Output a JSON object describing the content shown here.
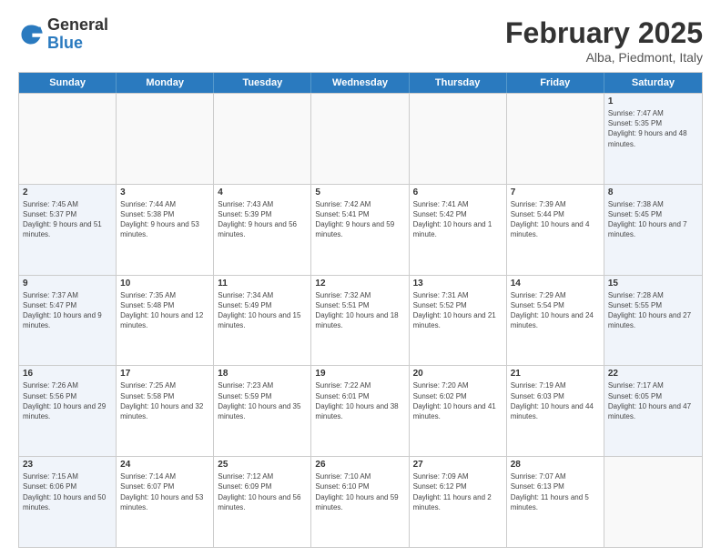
{
  "header": {
    "logo_general": "General",
    "logo_blue": "Blue",
    "month_title": "February 2025",
    "subtitle": "Alba, Piedmont, Italy"
  },
  "weekdays": [
    "Sunday",
    "Monday",
    "Tuesday",
    "Wednesday",
    "Thursday",
    "Friday",
    "Saturday"
  ],
  "rows": [
    [
      {
        "day": "",
        "info": "",
        "weekend": false,
        "empty": true
      },
      {
        "day": "",
        "info": "",
        "weekend": false,
        "empty": true
      },
      {
        "day": "",
        "info": "",
        "weekend": false,
        "empty": true
      },
      {
        "day": "",
        "info": "",
        "weekend": false,
        "empty": true
      },
      {
        "day": "",
        "info": "",
        "weekend": false,
        "empty": true
      },
      {
        "day": "",
        "info": "",
        "weekend": false,
        "empty": true
      },
      {
        "day": "1",
        "info": "Sunrise: 7:47 AM\nSunset: 5:35 PM\nDaylight: 9 hours and 48 minutes.",
        "weekend": true,
        "empty": false
      }
    ],
    [
      {
        "day": "2",
        "info": "Sunrise: 7:45 AM\nSunset: 5:37 PM\nDaylight: 9 hours and 51 minutes.",
        "weekend": true,
        "empty": false
      },
      {
        "day": "3",
        "info": "Sunrise: 7:44 AM\nSunset: 5:38 PM\nDaylight: 9 hours and 53 minutes.",
        "weekend": false,
        "empty": false
      },
      {
        "day": "4",
        "info": "Sunrise: 7:43 AM\nSunset: 5:39 PM\nDaylight: 9 hours and 56 minutes.",
        "weekend": false,
        "empty": false
      },
      {
        "day": "5",
        "info": "Sunrise: 7:42 AM\nSunset: 5:41 PM\nDaylight: 9 hours and 59 minutes.",
        "weekend": false,
        "empty": false
      },
      {
        "day": "6",
        "info": "Sunrise: 7:41 AM\nSunset: 5:42 PM\nDaylight: 10 hours and 1 minute.",
        "weekend": false,
        "empty": false
      },
      {
        "day": "7",
        "info": "Sunrise: 7:39 AM\nSunset: 5:44 PM\nDaylight: 10 hours and 4 minutes.",
        "weekend": false,
        "empty": false
      },
      {
        "day": "8",
        "info": "Sunrise: 7:38 AM\nSunset: 5:45 PM\nDaylight: 10 hours and 7 minutes.",
        "weekend": true,
        "empty": false
      }
    ],
    [
      {
        "day": "9",
        "info": "Sunrise: 7:37 AM\nSunset: 5:47 PM\nDaylight: 10 hours and 9 minutes.",
        "weekend": true,
        "empty": false
      },
      {
        "day": "10",
        "info": "Sunrise: 7:35 AM\nSunset: 5:48 PM\nDaylight: 10 hours and 12 minutes.",
        "weekend": false,
        "empty": false
      },
      {
        "day": "11",
        "info": "Sunrise: 7:34 AM\nSunset: 5:49 PM\nDaylight: 10 hours and 15 minutes.",
        "weekend": false,
        "empty": false
      },
      {
        "day": "12",
        "info": "Sunrise: 7:32 AM\nSunset: 5:51 PM\nDaylight: 10 hours and 18 minutes.",
        "weekend": false,
        "empty": false
      },
      {
        "day": "13",
        "info": "Sunrise: 7:31 AM\nSunset: 5:52 PM\nDaylight: 10 hours and 21 minutes.",
        "weekend": false,
        "empty": false
      },
      {
        "day": "14",
        "info": "Sunrise: 7:29 AM\nSunset: 5:54 PM\nDaylight: 10 hours and 24 minutes.",
        "weekend": false,
        "empty": false
      },
      {
        "day": "15",
        "info": "Sunrise: 7:28 AM\nSunset: 5:55 PM\nDaylight: 10 hours and 27 minutes.",
        "weekend": true,
        "empty": false
      }
    ],
    [
      {
        "day": "16",
        "info": "Sunrise: 7:26 AM\nSunset: 5:56 PM\nDaylight: 10 hours and 29 minutes.",
        "weekend": true,
        "empty": false
      },
      {
        "day": "17",
        "info": "Sunrise: 7:25 AM\nSunset: 5:58 PM\nDaylight: 10 hours and 32 minutes.",
        "weekend": false,
        "empty": false
      },
      {
        "day": "18",
        "info": "Sunrise: 7:23 AM\nSunset: 5:59 PM\nDaylight: 10 hours and 35 minutes.",
        "weekend": false,
        "empty": false
      },
      {
        "day": "19",
        "info": "Sunrise: 7:22 AM\nSunset: 6:01 PM\nDaylight: 10 hours and 38 minutes.",
        "weekend": false,
        "empty": false
      },
      {
        "day": "20",
        "info": "Sunrise: 7:20 AM\nSunset: 6:02 PM\nDaylight: 10 hours and 41 minutes.",
        "weekend": false,
        "empty": false
      },
      {
        "day": "21",
        "info": "Sunrise: 7:19 AM\nSunset: 6:03 PM\nDaylight: 10 hours and 44 minutes.",
        "weekend": false,
        "empty": false
      },
      {
        "day": "22",
        "info": "Sunrise: 7:17 AM\nSunset: 6:05 PM\nDaylight: 10 hours and 47 minutes.",
        "weekend": true,
        "empty": false
      }
    ],
    [
      {
        "day": "23",
        "info": "Sunrise: 7:15 AM\nSunset: 6:06 PM\nDaylight: 10 hours and 50 minutes.",
        "weekend": true,
        "empty": false
      },
      {
        "day": "24",
        "info": "Sunrise: 7:14 AM\nSunset: 6:07 PM\nDaylight: 10 hours and 53 minutes.",
        "weekend": false,
        "empty": false
      },
      {
        "day": "25",
        "info": "Sunrise: 7:12 AM\nSunset: 6:09 PM\nDaylight: 10 hours and 56 minutes.",
        "weekend": false,
        "empty": false
      },
      {
        "day": "26",
        "info": "Sunrise: 7:10 AM\nSunset: 6:10 PM\nDaylight: 10 hours and 59 minutes.",
        "weekend": false,
        "empty": false
      },
      {
        "day": "27",
        "info": "Sunrise: 7:09 AM\nSunset: 6:12 PM\nDaylight: 11 hours and 2 minutes.",
        "weekend": false,
        "empty": false
      },
      {
        "day": "28",
        "info": "Sunrise: 7:07 AM\nSunset: 6:13 PM\nDaylight: 11 hours and 5 minutes.",
        "weekend": false,
        "empty": false
      },
      {
        "day": "",
        "info": "",
        "weekend": true,
        "empty": true
      }
    ]
  ]
}
